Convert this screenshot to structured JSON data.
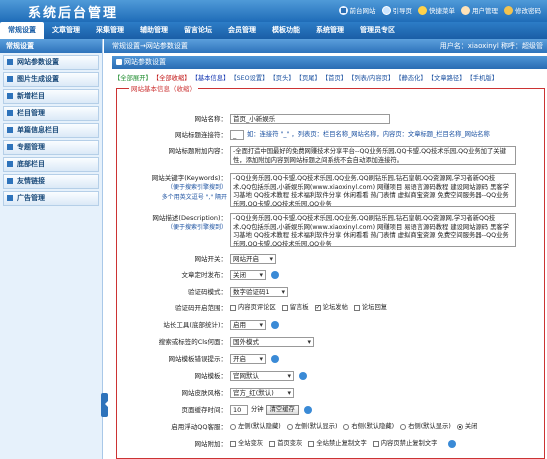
{
  "app": {
    "title": "系统后台管理"
  },
  "toplinks": [
    {
      "label": "前台网站",
      "icon": "home-icon"
    },
    {
      "label": "引导页",
      "icon": "globe-icon"
    },
    {
      "label": "快捷菜单",
      "icon": "star-icon"
    },
    {
      "label": "用户管理",
      "icon": "user-icon"
    },
    {
      "label": "修改密码",
      "icon": "key-icon"
    }
  ],
  "menu": [
    "常规设置",
    "文章管理",
    "采集管理",
    "辅助管理",
    "留言论坛",
    "会员管理",
    "模板功能",
    "系统管理",
    "管理员专区"
  ],
  "sidebar": {
    "title": "常规设置",
    "items": [
      "网站参数设置",
      "图片生成设置",
      "新增栏目",
      "栏目管理",
      "单篇信息栏目",
      "专题管理",
      "底部栏目",
      "友情链接",
      "广告管理"
    ]
  },
  "breadcrumb": "常规设置→网站参数设置",
  "account": {
    "user": "用户名：xiaoxinyl",
    "role": "称呼：超级管"
  },
  "panel": {
    "title": "网站参数设置"
  },
  "filters": [
    {
      "label": "【全部展开】",
      "color": "g"
    },
    {
      "label": "【全部收缩】",
      "color": "r"
    },
    {
      "label": "【基本信息】",
      "color": "b"
    },
    {
      "label": "【SEO设置】",
      "color": ""
    },
    {
      "label": "【页头】",
      "color": ""
    },
    {
      "label": "【页尾】",
      "color": ""
    },
    {
      "label": "【首页】",
      "color": ""
    },
    {
      "label": "【列表/内容页】",
      "color": ""
    },
    {
      "label": "【静态化】",
      "color": ""
    },
    {
      "label": "【文章路径】",
      "color": ""
    },
    {
      "label": "【手机版】",
      "color": ""
    }
  ],
  "section": {
    "legend": "网站基本信息（收缩）"
  },
  "form": {
    "site_name": {
      "label": "网站名称：",
      "value": "首页_小新娱乐"
    },
    "title_link": {
      "label": "网站标题连接符：",
      "value": "_",
      "hint": "如：连接符 \"_\" ，列表页：栏目名称_网站名称，内容页：文章标题_栏目名称_网站名称"
    },
    "title_suffix": {
      "label": "网站标题附加内容：",
      "value": "-全面打造中国最好的免费网赚技术分享平台--QQ业务乐园,QQ卡盟,QQ技术乐园,QQ业务加了关键性，添加附加内容到网站标题之间系统不会自动添加连接符。"
    },
    "keywords": {
      "label": "网站关键字(Keywords)：",
      "sub": "（便于搜索引擎搜到）",
      "sub2": "多个用英文逗号 \",\" 隔开",
      "value": "-QQ业务乐园,QQ卡盟,QQ技术乐园,QQ业务,QQ刷钻乐园,钻石皇朝,QQ资源网,学习者新QQ技术,QQ包括乐园,小新娱乐网(www.xiaoxinyl.com) 网赚项目 易语言源码教程 建设网站源码 黑客学习基地 QQ技术教程 技术福利软件分享 休闲看看 热门表情 虚拟商宝资源 免费空间服务器--QQ业务乐园,QQ卡盟,QQ技术乐园,QQ业务"
    },
    "description": {
      "label": "网站描述(Description)：",
      "sub": "（便于搜索引擎搜到）",
      "value": "-QQ业务乐园,QQ卡盟,QQ技术乐园,QQ业务,QQ刷钻乐园,钻石皇朝,QQ资源网,学习者新QQ技术,QQ包括乐园,小新娱乐网(www.xiaoxinyl.com) 网赚项目 易语言源码教程 建设网站源码 黑客学习基地 QQ技术教程 技术福利软件分享 休闲看看 热门表情 虚拟商宝资源 免费空间服务器--QQ业务乐园,QQ卡盟,QQ技术乐园,QQ业务"
    },
    "site_switch": {
      "label": "网站开关：",
      "value": "网站开启"
    },
    "timed_publish": {
      "label": "文章定时发布：",
      "value": "关闭"
    },
    "captcha": {
      "label": "验证码模式：",
      "value": "数字验证码1"
    },
    "captcha_scope": {
      "label": "验证码开启范围：",
      "options": [
        {
          "label": "内容页评论区",
          "on": false
        },
        {
          "label": "留言板",
          "on": false
        },
        {
          "label": "论坛发帖",
          "on": true
        },
        {
          "label": "论坛回复",
          "on": false
        }
      ]
    },
    "toolbar": {
      "label": "站长工具(底部统计)：",
      "value": "启用"
    },
    "search_range": {
      "label": "搜索或标签的Cls何面：",
      "value": "国外模式"
    },
    "template_error": {
      "label": "网站模板错误提示：",
      "value": "开启"
    },
    "template": {
      "label": "网站模板：",
      "value": "官网默认"
    },
    "skin": {
      "label": "网站皮肤风格：",
      "value": "官方_红(默认)"
    },
    "cache": {
      "label": "页面缓存时间：",
      "value": "10",
      "unit": "分钟",
      "button": "清空缓存"
    },
    "qq_float": {
      "label": "启用浮动QQ客服：",
      "options": [
        {
          "label": "左侧(默认隐藏)",
          "on": false
        },
        {
          "label": "左侧(默认显示)",
          "on": false
        },
        {
          "label": "右侧(默认隐藏)",
          "on": false
        },
        {
          "label": "右侧(默认显示)",
          "on": false
        },
        {
          "label": "关闭",
          "on": true
        }
      ]
    },
    "extra": {
      "label": "网站附加：",
      "options": [
        {
          "label": "全站变灰",
          "on": false
        },
        {
          "label": "首页变灰",
          "on": false
        },
        {
          "label": "全站禁止复制文字",
          "on": false
        },
        {
          "label": "内容页禁止复制文字",
          "on": false
        }
      ]
    }
  }
}
